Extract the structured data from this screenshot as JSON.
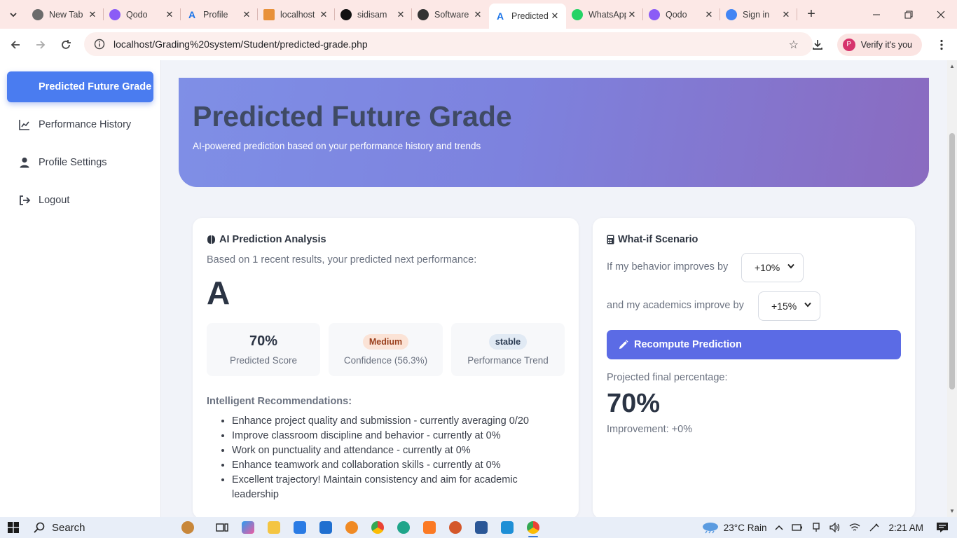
{
  "browser": {
    "tabs": [
      {
        "title": "New Tab",
        "favicon": "chrome-icon",
        "color": "#6b6b6b"
      },
      {
        "title": "Qodo",
        "favicon": "qodo-icon",
        "color": "#8b5cf6"
      },
      {
        "title": "Profile",
        "favicon": "a-logo-icon",
        "color": "#1a73e8"
      },
      {
        "title": "localhost",
        "favicon": "pma-icon",
        "color": "#e8913a"
      },
      {
        "title": "sidisam",
        "favicon": "github-icon",
        "color": "#111111"
      },
      {
        "title": "Software",
        "favicon": "openai-icon",
        "color": "#333333"
      },
      {
        "title": "Predicted",
        "favicon": "a-logo-icon",
        "color": "#1a73e8",
        "active": true
      },
      {
        "title": "WhatsApp",
        "favicon": "whatsapp-icon",
        "color": "#25d366"
      },
      {
        "title": "Qodo",
        "favicon": "qodo-icon",
        "color": "#8b5cf6"
      },
      {
        "title": "Sign in",
        "favicon": "google-icon",
        "color": "#4285f4"
      }
    ],
    "url": "localhost/Grading%20system/Student/predicted-grade.php",
    "verify_label": "Verify it's you",
    "avatar_letter": "P"
  },
  "sidebar": {
    "active": "Predicted Future Grade",
    "items": [
      {
        "label": "Performance History",
        "icon": "chart-line-icon"
      },
      {
        "label": "Profile Settings",
        "icon": "user-icon"
      },
      {
        "label": "Logout",
        "icon": "logout-icon"
      }
    ]
  },
  "hero": {
    "title": "Predicted Future Grade",
    "subtitle": "AI-powered prediction based on your performance history and trends"
  },
  "analysis": {
    "title": "AI Prediction Analysis",
    "intro": "Based on 1 recent results, your predicted next performance:",
    "grade": "A",
    "stats": [
      {
        "value": "70%",
        "label": "Predicted Score"
      },
      {
        "badge": "Medium",
        "label": "Confidence (56.3%)"
      },
      {
        "badge": "stable",
        "label": "Performance Trend"
      }
    ],
    "recommendations_title": "Intelligent Recommendations:",
    "recommendations": [
      "Enhance project quality and submission - currently averaging 0/20",
      "Improve classroom discipline and behavior - currently at 0%",
      "Work on punctuality and attendance - currently at 0%",
      "Enhance teamwork and collaboration skills - currently at 0%",
      "Excellent trajectory! Maintain consistency and aim for academic leadership"
    ]
  },
  "whatif": {
    "title": "What-if Scenario",
    "behavior_label": "If my behavior improves by",
    "behavior_value": "+10%",
    "academics_label": "and my academics improve by",
    "academics_value": "+15%",
    "button_label": "Recompute Prediction",
    "projected_label": "Projected final percentage:",
    "projected_value": "70%",
    "improvement": "Improvement: +0%"
  },
  "taskbar": {
    "search_label": "Search",
    "weather": "23°C  Rain",
    "time": "2:21 AM"
  }
}
